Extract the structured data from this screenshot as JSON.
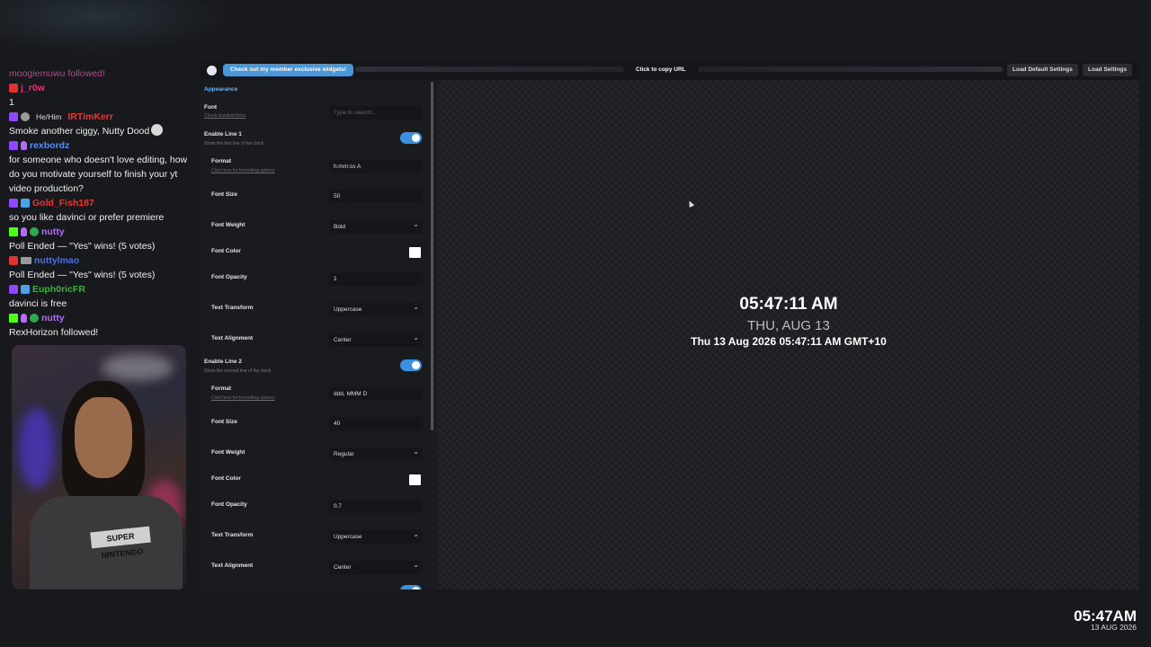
{
  "chat": {
    "messages": [
      {
        "type": "event",
        "text": "moogiemuwu followed!",
        "color": "#b04a8a"
      },
      {
        "type": "msg",
        "badges": [
          "youtube"
        ],
        "user": "j_r0w",
        "color": "#e0357a",
        "text": "1"
      },
      {
        "type": "msg",
        "badges": [
          "twitch",
          "gear"
        ],
        "pronoun": "He/Him",
        "user": "IRTimKerr",
        "color": "#e53935",
        "text": "Smoke another ciggy, Nutty Dood",
        "emote": true
      },
      {
        "type": "msg",
        "badges": [
          "twitch",
          "mic"
        ],
        "user": "rexbordz",
        "color": "#5b8ff0",
        "text": "for someone who doesn't love editing, how do you motivate yourself to finish your yt video production?"
      },
      {
        "type": "msg",
        "badges": [
          "twitch",
          "sub"
        ],
        "user": "Gold_Fish187",
        "color": "#e53935",
        "text": "so you like davinci or prefer premiere"
      },
      {
        "type": "msg",
        "badges": [
          "kick",
          "mic",
          "mod"
        ],
        "user": "nutty",
        "color": "#b36cff",
        "text": "Poll Ended — \"Yes\" wins! (5 votes)"
      },
      {
        "type": "msg",
        "badges": [
          "youtube",
          "video"
        ],
        "user": "nuttylmao",
        "color": "#4a70e0",
        "text": "Poll Ended — \"Yes\" wins! (5 votes)"
      },
      {
        "type": "msg",
        "badges": [
          "twitch",
          "sub"
        ],
        "user": "Euph0ricFR",
        "color": "#3fae3f",
        "text": "davinci is free"
      },
      {
        "type": "msg",
        "badges": [
          "kick",
          "mic",
          "mod"
        ],
        "user": "nutty",
        "color": "#b36cff",
        "text": "RexHorizon followed!"
      }
    ]
  },
  "webcam": {
    "shirt_text": "SUPER NINTENDO"
  },
  "topbar": {
    "promo_label": "Check out my member exclusive widgets!",
    "copy_url_label": "Click to copy URL",
    "load_default_label": "Load Default Settings",
    "load_settings_label": "Load Settings"
  },
  "settings": {
    "section_title": "Appearance",
    "font": {
      "label": "Font",
      "link": "Check installed fonts",
      "placeholder": "Type to search..."
    },
    "line1": {
      "label": "Enable Line 1",
      "desc": "Show the first line of the clock",
      "format_label": "Format",
      "format_link": "Click here for formatting options",
      "format_value": "h:mm:ss A",
      "size_label": "Font Size",
      "size_value": "50",
      "weight_label": "Font Weight",
      "weight_value": "Bold",
      "color_label": "Font Color",
      "opacity_label": "Font Opacity",
      "opacity_value": "1",
      "transform_label": "Text Transform",
      "transform_value": "Uppercase",
      "align_label": "Text Alignment",
      "align_value": "Center"
    },
    "line2": {
      "label": "Enable Line 2",
      "desc": "Show the second line of the clock",
      "format_label": "Format",
      "format_link": "Click here for formatting options",
      "format_value": "ddd, MMM D",
      "size_label": "Font Size",
      "size_value": "40",
      "weight_label": "Font Weight",
      "weight_value": "Regular",
      "color_label": "Font Color",
      "opacity_label": "Font Opacity",
      "opacity_value": "0.7",
      "transform_label": "Text Transform",
      "transform_value": "Uppercase",
      "align_label": "Text Alignment",
      "align_value": "Center"
    }
  },
  "preview": {
    "line1": "05:47:11 AM",
    "line2": "THU, AUG 13",
    "line3": "Thu 13 Aug 2026 05:47:11 AM GMT+10"
  },
  "stream_clock": {
    "time": "05:47AM",
    "date": "13 AUG 2026"
  },
  "colors": {
    "accent": "#3a91e0",
    "section_title": "#6fb3f0",
    "promo": "#4a97d8"
  }
}
